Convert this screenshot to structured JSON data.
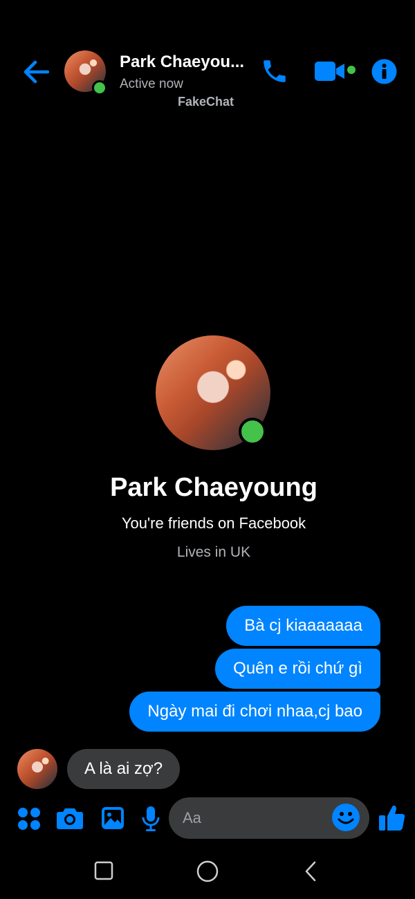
{
  "header": {
    "contact_name": "Park Chaeyou...",
    "status": "Active now",
    "watermark": "FakeChat"
  },
  "profile": {
    "name": "Park Chaeyoung",
    "relationship": "You're friends on Facebook",
    "location": "Lives in UK"
  },
  "messages": {
    "outgoing": [
      "Bà cj kiaaaaaaa",
      "Quên e rồi chứ gì",
      "Ngày mai đi chơi nhaa,cj bao"
    ],
    "incoming": [
      "A là ai zợ?"
    ]
  },
  "composer": {
    "placeholder": "Aa"
  },
  "colors": {
    "accent": "#0084ff",
    "online": "#44c24a",
    "incoming_bubble": "#3a3b3c",
    "background": "#000000"
  },
  "icons": [
    "back-arrow-icon",
    "phone-icon",
    "video-camera-icon",
    "info-icon",
    "apps-grid-icon",
    "camera-icon",
    "image-icon",
    "microphone-icon",
    "emoji-icon",
    "thumbs-up-icon",
    "recent-apps-icon",
    "home-icon",
    "back-icon"
  ]
}
